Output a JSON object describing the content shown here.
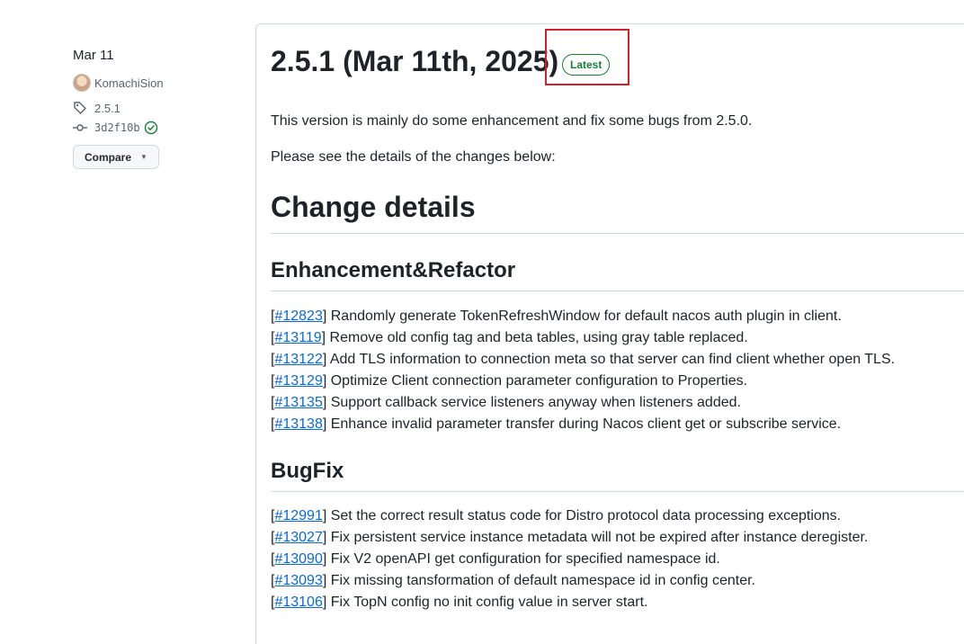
{
  "sidebar": {
    "date": "Mar 11",
    "author": "KomachiSion",
    "tag": "2.5.1",
    "commit": "3d2f10b",
    "compare_label": "Compare"
  },
  "release": {
    "title": "2.5.1 (Mar 11th, 2025)",
    "badge": "Latest",
    "intro": "This version is mainly do some enhancement and fix some bugs from 2.5.0.",
    "intro2": "Please see the details of the changes below:",
    "change_heading": "Change details",
    "enhancement_heading": "Enhancement&Refactor",
    "enhancements": [
      {
        "id": "#12823",
        "text": "Randomly generate TokenRefreshWindow for default nacos auth plugin in client."
      },
      {
        "id": "#13119",
        "text": "Remove old config tag and beta tables, using gray table replaced."
      },
      {
        "id": "#13122",
        "text": "Add TLS information to connection meta so that server can find client whether open TLS."
      },
      {
        "id": "#13129",
        "text": "Optimize Client connection parameter configuration to Properties."
      },
      {
        "id": "#13135",
        "text": "Support callback service listeners anyway when listeners added."
      },
      {
        "id": "#13138",
        "text": "Enhance invalid parameter transfer during Nacos client get or subscribe service."
      }
    ],
    "bugfix_heading": "BugFix",
    "bugfixes": [
      {
        "id": "#12991",
        "text": "Set the correct result status code for Distro protocol data processing exceptions."
      },
      {
        "id": "#13027",
        "text": "Fix persistent service instance metadata will not be expired after instance deregister."
      },
      {
        "id": "#13090",
        "text": "Fix V2 openAPI get configuration for specified namespace id."
      },
      {
        "id": "#13093",
        "text": "Fix missing tansformation of default namespace id in config center."
      },
      {
        "id": "#13106",
        "text": "Fix TopN config no init config value in server start."
      }
    ]
  },
  "colors": {
    "link": "#0969da",
    "badge_green": "#1a7f37",
    "highlight_red": "#cf222e"
  }
}
